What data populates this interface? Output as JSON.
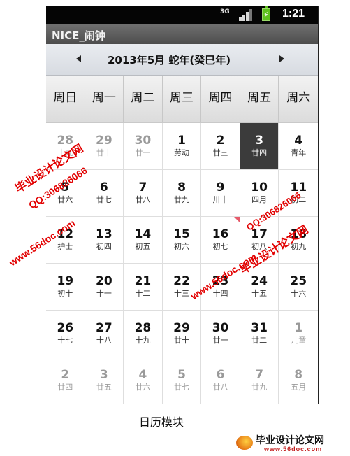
{
  "status_bar": {
    "network": "3G",
    "time": "1:21"
  },
  "app": {
    "title": "NICE_闹钟"
  },
  "month_nav": {
    "title": "2013年5月   蛇年(癸巳年)"
  },
  "weekdays": [
    "周日",
    "周一",
    "周二",
    "周三",
    "周四",
    "周五",
    "周六"
  ],
  "days": [
    {
      "num": "28",
      "lunar": "十九",
      "other": true
    },
    {
      "num": "29",
      "lunar": "廿十",
      "other": true
    },
    {
      "num": "30",
      "lunar": "廿一",
      "other": true
    },
    {
      "num": "1",
      "lunar": "劳动"
    },
    {
      "num": "2",
      "lunar": "廿三"
    },
    {
      "num": "3",
      "lunar": "廿四",
      "selected": true
    },
    {
      "num": "4",
      "lunar": "青年"
    },
    {
      "num": "5",
      "lunar": "廿六"
    },
    {
      "num": "6",
      "lunar": "廿七"
    },
    {
      "num": "7",
      "lunar": "廿八"
    },
    {
      "num": "8",
      "lunar": "廿九"
    },
    {
      "num": "9",
      "lunar": "卅十"
    },
    {
      "num": "10",
      "lunar": "四月"
    },
    {
      "num": "11",
      "lunar": "初二"
    },
    {
      "num": "12",
      "lunar": "护士"
    },
    {
      "num": "13",
      "lunar": "初四"
    },
    {
      "num": "14",
      "lunar": "初五"
    },
    {
      "num": "15",
      "lunar": "初六"
    },
    {
      "num": "16",
      "lunar": "初七",
      "event": true
    },
    {
      "num": "17",
      "lunar": "初八"
    },
    {
      "num": "18",
      "lunar": "初九"
    },
    {
      "num": "19",
      "lunar": "初十"
    },
    {
      "num": "20",
      "lunar": "十一"
    },
    {
      "num": "21",
      "lunar": "十二"
    },
    {
      "num": "22",
      "lunar": "十三"
    },
    {
      "num": "23",
      "lunar": "十四"
    },
    {
      "num": "24",
      "lunar": "十五"
    },
    {
      "num": "25",
      "lunar": "十六"
    },
    {
      "num": "26",
      "lunar": "十七"
    },
    {
      "num": "27",
      "lunar": "十八"
    },
    {
      "num": "28",
      "lunar": "十九"
    },
    {
      "num": "29",
      "lunar": "廿十"
    },
    {
      "num": "30",
      "lunar": "廿一"
    },
    {
      "num": "31",
      "lunar": "廿二"
    },
    {
      "num": "1",
      "lunar": "儿童",
      "other": true
    },
    {
      "num": "2",
      "lunar": "廿四",
      "other": true
    },
    {
      "num": "3",
      "lunar": "廿五",
      "other": true
    },
    {
      "num": "4",
      "lunar": "廿六",
      "other": true
    },
    {
      "num": "5",
      "lunar": "廿七",
      "other": true
    },
    {
      "num": "6",
      "lunar": "廿八",
      "other": true
    },
    {
      "num": "7",
      "lunar": "廿九",
      "other": true
    },
    {
      "num": "8",
      "lunar": "五月",
      "other": true
    }
  ],
  "caption": "日历模块",
  "watermarks": {
    "site_name": "毕业设计论文网",
    "qq": "QQ:306826066",
    "url": "www.56doc.com"
  },
  "logo": {
    "text": "毕业设计论文网",
    "url": "www.56doc.com"
  },
  "colors": {
    "selected_bg": "#3b3b3b",
    "watermark": "#e20000",
    "battery": "#5ec21d"
  }
}
